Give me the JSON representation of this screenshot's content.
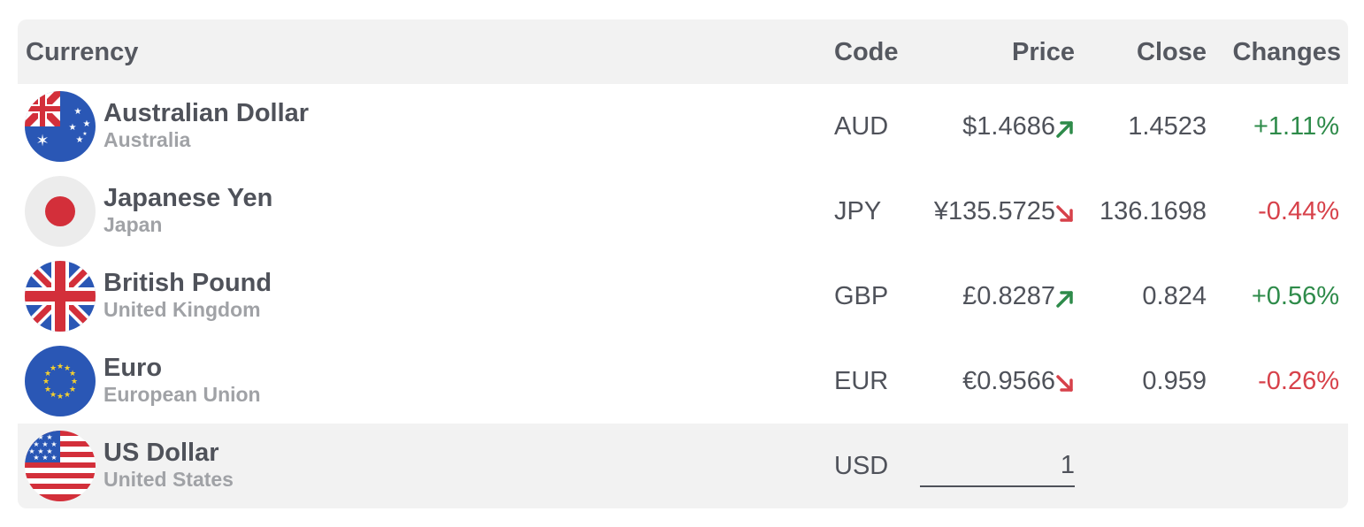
{
  "header": {
    "currency": "Currency",
    "code": "Code",
    "price": "Price",
    "close": "Close",
    "changes": "Changes"
  },
  "rows": [
    {
      "name": "Australian Dollar",
      "country": "Australia",
      "code": "AUD",
      "price": "$1.4686",
      "trend": "up",
      "close": "1.4523",
      "change": "+1.11%",
      "flag_icon": "australia-flag-icon"
    },
    {
      "name": "Japanese Yen",
      "country": "Japan",
      "code": "JPY",
      "price": "¥135.5725",
      "trend": "down",
      "close": "136.1698",
      "change": "-0.44%",
      "flag_icon": "japan-flag-icon"
    },
    {
      "name": "British Pound",
      "country": "United Kingdom",
      "code": "GBP",
      "price": "£0.8287",
      "trend": "up",
      "close": "0.824",
      "change": "+0.56%",
      "flag_icon": "uk-flag-icon"
    },
    {
      "name": "Euro",
      "country": "European Union",
      "code": "EUR",
      "price": "€0.9566",
      "trend": "down",
      "close": "0.959",
      "change": "-0.26%",
      "flag_icon": "eu-flag-icon"
    }
  ],
  "base": {
    "name": "US Dollar",
    "country": "United States",
    "code": "USD",
    "amount": "1",
    "flag_icon": "us-flag-icon"
  },
  "colors": {
    "up": "#2e8b4a",
    "down": "#d7414a",
    "header_bg": "#f2f2f2"
  }
}
